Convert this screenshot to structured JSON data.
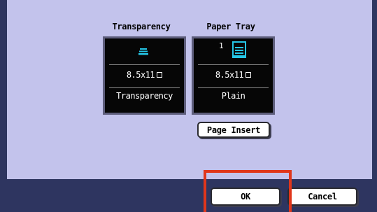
{
  "colors": {
    "panel": "#c3c3ec",
    "frame": "#2e3560",
    "tile_bg": "#060606",
    "tray_cyan": "#25c6e6",
    "highlight": "#e0361b"
  },
  "sources": [
    {
      "label": "Transparency",
      "size": "8.5x11",
      "type": "Transparency",
      "icon": "transparency-stack-icon"
    },
    {
      "label": "Paper Tray",
      "tray_number": "1",
      "size": "8.5x11",
      "type": "Plain",
      "icon": "paper-tray-icon"
    }
  ],
  "buttons": {
    "page_insert": "Page Insert",
    "ok": "OK",
    "cancel": "Cancel"
  }
}
